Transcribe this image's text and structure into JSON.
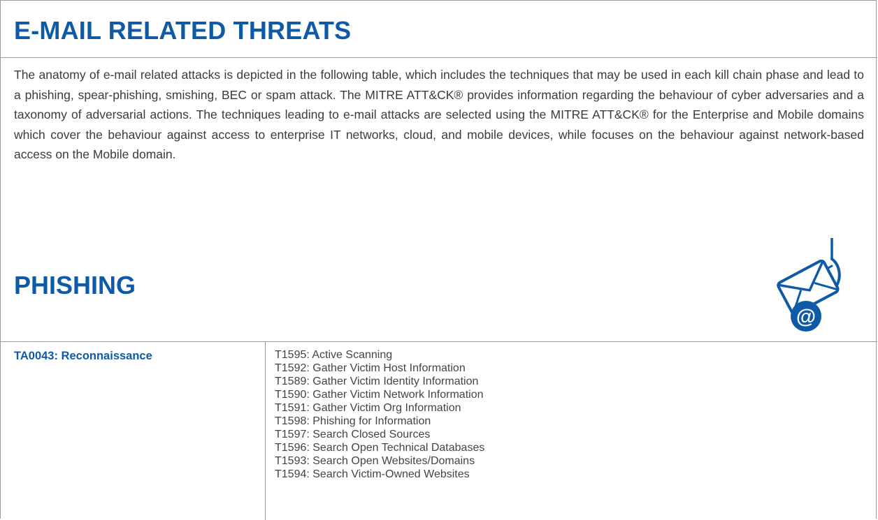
{
  "header": {
    "title": "E-MAIL RELATED THREATS"
  },
  "intro": {
    "text": "The anatomy of e-mail related attacks is depicted in the following table, which includes the techniques that may be used in each kill chain phase and lead to a phishing, spear-phishing, smishing, BEC or spam attack. The MITRE ATT&CK® provides information regarding the behaviour of cyber adversaries and a taxonomy of adversarial actions. The techniques leading to e-mail attacks are selected using the MITRE ATT&CK® for the Enterprise and Mobile domains which cover the behaviour against access to enterprise IT networks, cloud, and mobile devices, while focuses on the behaviour against network-based access on the Mobile domain."
  },
  "section": {
    "title": "PHISHING",
    "icon": "phishing-email-hook-icon"
  },
  "table": {
    "tactic": "TA0043: Reconnaissance",
    "techniques": [
      "T1595: Active Scanning",
      "T1592: Gather Victim Host Information",
      "T1589: Gather Victim Identity Information",
      "T1590: Gather Victim Network Information",
      "T1591: Gather Victim Org Information",
      "T1598: Phishing for Information",
      "T1597: Search Closed Sources",
      "T1596: Search Open Technical Databases",
      "T1593: Search Open Websites/Domains",
      "T1594: Search Victim-Owned Websites"
    ]
  },
  "colors": {
    "accent": "#0f5aa7",
    "body_text": "#3b3b3b",
    "border": "#9a9a9a"
  }
}
